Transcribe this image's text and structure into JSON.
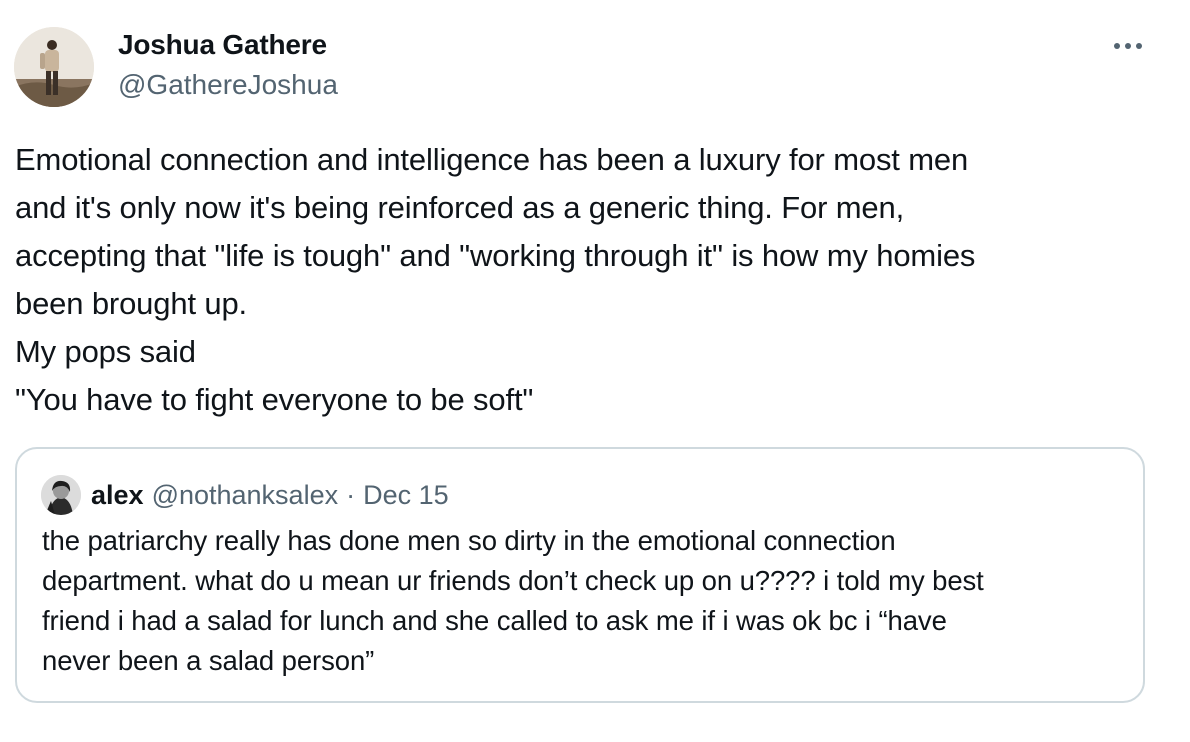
{
  "tweet": {
    "author": {
      "name": "Joshua Gathere",
      "handle": "@GathereJoshua",
      "avatar_icon": "profile-photo-icon"
    },
    "more_icon": "more-options-icon",
    "text_lines": [
      "Emotional connection and intelligence has been a luxury for most men",
      "and it's only now it's being reinforced as a generic thing. For men,",
      "accepting that \"life is tough\" and \"working through it\" is how my homies",
      "been brought up.",
      "My pops said",
      "\"You have to fight everyone to be soft\""
    ]
  },
  "quote": {
    "author": {
      "name": "alex",
      "handle": "@nothanksalex",
      "avatar_icon": "profile-photo-icon"
    },
    "separator": "·",
    "date": "Dec 15",
    "text_lines": [
      "the patriarchy really has done men so dirty in the emotional connection",
      "department. what do u mean ur friends don’t check up on u???? i told my best",
      "friend i had a salad for lunch and she called to ask me if i was ok bc i “have",
      "never been a salad person”"
    ]
  },
  "colors": {
    "text_primary": "#0f1419",
    "text_secondary": "#536471",
    "border": "#cfd9de",
    "background": "#ffffff"
  }
}
